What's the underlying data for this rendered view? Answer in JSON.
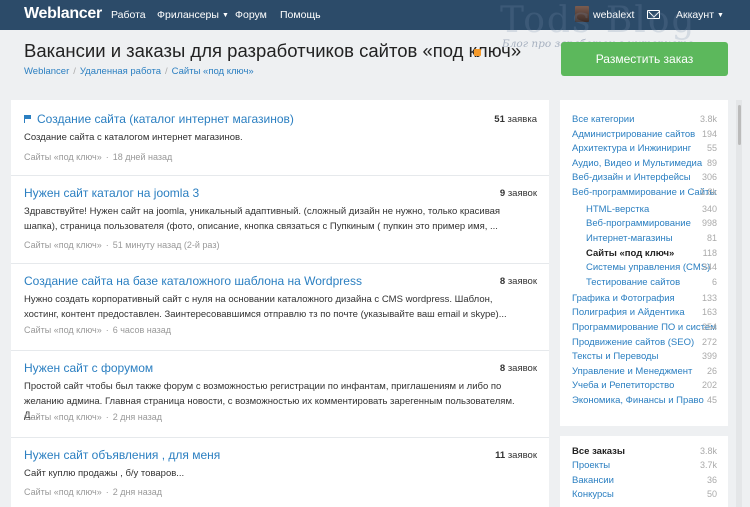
{
  "nav": {
    "logo": "Weblancer",
    "items": [
      "Работа",
      "Фрилансеры",
      "Форум",
      "Помощь"
    ],
    "username": "webalext",
    "account": "Аккаунт"
  },
  "watermark": {
    "big": "Tods Blog",
    "small": "Блог про заработок в интернете"
  },
  "header": {
    "title": "Вакансии и заказы для разработчиков сайтов «под ключ»",
    "breadcrumb": [
      "Weblancer",
      "Удаленная работа",
      "Сайты «под ключ»"
    ],
    "post_button": "Разместить заказ"
  },
  "jobs": [
    {
      "title": "Создание сайта (каталог интернет магазинов)",
      "flagged": true,
      "bids_num": "51",
      "bids_word": "заявка",
      "desc": "Создание сайта с каталогом интернет магазинов.",
      "category": "Сайты «под ключ»",
      "time": "18 дней назад"
    },
    {
      "title": "Нужен сайт каталог на joomla 3",
      "flagged": false,
      "bids_num": "9",
      "bids_word": "заявок",
      "desc": "Здравствуйте! Нужен сайт на joomla, уникальный адаптивный. (сложный дизайн не нужно, только красивая шапка), страница пользователя (фото, описание, кнопка связаться с Пупкиным ( пупкин это пример имя, ...",
      "category": "Сайты «под ключ»",
      "time": "51 минуту назад (2-й раз)"
    },
    {
      "title": "Создание сайта на базе каталожного шаблона на Wordpress",
      "flagged": false,
      "bids_num": "8",
      "bids_word": "заявок",
      "desc": "Нужно создать корпоративный сайт с нуля на основании каталожного дизайна с CMS wordpress. Шаблон, хостинг, контент предоставлен. Заинтересовавшимся отправлю тз по почте (указывайте ваш email и skype)...",
      "category": "Сайты «под ключ»",
      "time": "6 часов назад"
    },
    {
      "title": "Нужен сайт с форумом",
      "flagged": false,
      "bids_num": "8",
      "bids_word": "заявок",
      "desc": "Простой сайт чтобы был также форум с возможностью регистрации по инфантам, приглашениям и либо по желанию админа. Главная страница новости, с возможностью их комментировать зарегенным пользователям. Д...",
      "category": "Сайты «под ключ»",
      "time": "2 дня назад"
    },
    {
      "title": "Нужен сайт объявления , для меня",
      "flagged": false,
      "bids_num": "11",
      "bids_word": "заявок",
      "desc": "Сайт куплю продажы , б/у товаров...",
      "category": "Сайты «под ключ»",
      "time": "2 дня назад"
    }
  ],
  "categories": [
    {
      "label": "Все категории",
      "count": "3.8k"
    },
    {
      "label": "Администрирование сайтов",
      "count": "194"
    },
    {
      "label": "Архитектура и Инжиниринг",
      "count": "55"
    },
    {
      "label": "Аудио, Видео и Мультимедиа",
      "count": "89"
    },
    {
      "label": "Веб-дизайн и Интерфейсы",
      "count": "306"
    },
    {
      "label": "Веб-программирование и Сайты",
      "count": "1.8k"
    },
    {
      "label": "HTML-верстка",
      "count": "340",
      "sub": true
    },
    {
      "label": "Веб-программирование",
      "count": "998",
      "sub": true
    },
    {
      "label": "Интернет-магазины",
      "count": "81",
      "sub": true
    },
    {
      "label": "Сайты «под ключ»",
      "count": "118",
      "sub": true,
      "active": true
    },
    {
      "label": "Системы управления (CMS)",
      "count": "244",
      "sub": true
    },
    {
      "label": "Тестирование сайтов",
      "count": "6",
      "sub": true
    },
    {
      "label": "Графика и Фотография",
      "count": "133"
    },
    {
      "label": "Полиграфия и Айдентика",
      "count": "163"
    },
    {
      "label": "Программирование ПО и систем",
      "count": "254"
    },
    {
      "label": "Продвижение сайтов (SEO)",
      "count": "272"
    },
    {
      "label": "Тексты и Переводы",
      "count": "399"
    },
    {
      "label": "Управление и Менеджмент",
      "count": "26"
    },
    {
      "label": "Учеба и Репетиторство",
      "count": "202"
    },
    {
      "label": "Экономика, Финансы и Право",
      "count": "45"
    }
  ],
  "types": [
    {
      "label": "Все заказы",
      "count": "3.8k",
      "active": true
    },
    {
      "label": "Проекты",
      "count": "3.7k"
    },
    {
      "label": "Вакансии",
      "count": "36"
    },
    {
      "label": "Конкурсы",
      "count": "50"
    }
  ]
}
